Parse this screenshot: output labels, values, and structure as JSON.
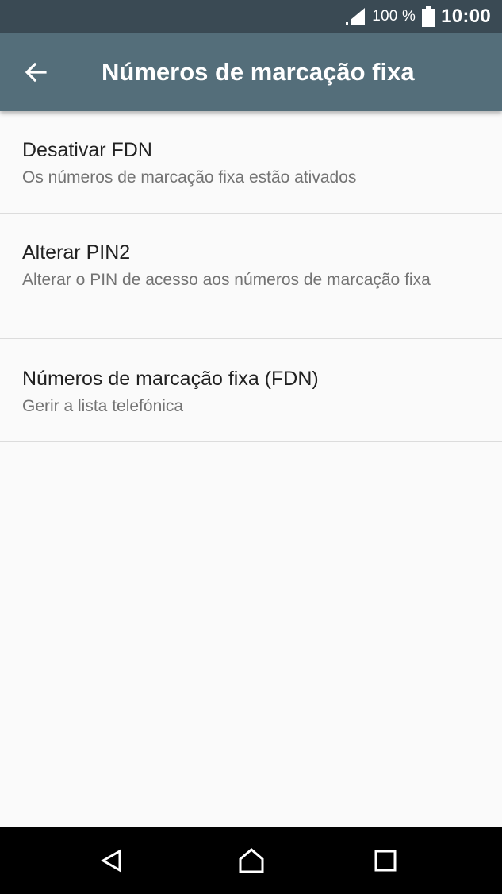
{
  "status_bar": {
    "battery_text": "100 %",
    "time": "10:00",
    "icons": [
      "signal-icon",
      "battery-icon"
    ]
  },
  "app_bar": {
    "title": "Números de marcação fixa",
    "back_icon": "arrow-left-icon"
  },
  "items": [
    {
      "title": "Desativar FDN",
      "summary": "Os números de marcação fixa estão ativados"
    },
    {
      "title": "Alterar PIN2",
      "summary": "Alterar o PIN de acesso aos números de marcação fixa"
    },
    {
      "title": "Números de marcação fixa (FDN)",
      "summary": "Gerir a lista telefónica"
    }
  ],
  "nav_bar": {
    "icons": [
      "nav-back-icon",
      "nav-home-icon",
      "nav-recents-icon"
    ]
  },
  "colors": {
    "status_bar": "#3a4a54",
    "app_bar": "#546e7a",
    "background": "#fafafa",
    "title_text": "#212121",
    "summary_text": "#737373",
    "divider": "#dcdcdc",
    "nav_bar": "#000000"
  }
}
